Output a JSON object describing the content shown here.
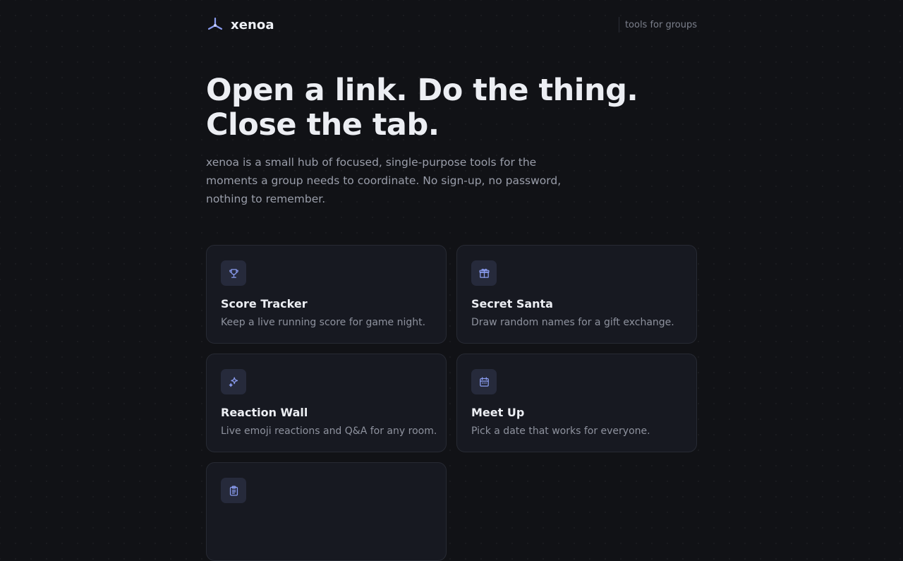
{
  "brand": {
    "name": "xenoa",
    "icon": "tri-branch-logo-icon"
  },
  "header": {
    "tagline": "tools for groups"
  },
  "hero": {
    "title_line1": "Open a link. Do the thing.",
    "title_line2": "Close the tab.",
    "description": "xenoa is a small hub of focused, single-purpose tools for the moments a group needs to coordinate. No sign-up, no password, nothing to remember."
  },
  "tools": [
    {
      "title": "Score Tracker",
      "desc": "Keep a live running score for game night.",
      "icon": "trophy-icon"
    },
    {
      "title": "Secret Santa",
      "desc": "Draw random names for a gift exchange.",
      "icon": "gift-icon"
    },
    {
      "title": "Reaction Wall",
      "desc": "Live emoji reactions and Q&A for any room.",
      "icon": "sparkles-icon"
    },
    {
      "title": "Meet Up",
      "desc": "Pick a date that works for everyone.",
      "icon": "calendar-icon"
    },
    {
      "title": "",
      "desc": "",
      "icon": "clipboard-icon"
    }
  ],
  "colors": {
    "accent": "#8a9cf0",
    "background": "#111216",
    "card": "#171921"
  }
}
